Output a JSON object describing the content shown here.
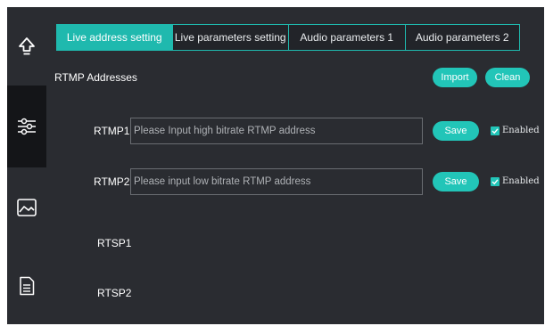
{
  "sidebar": {
    "items": [
      {
        "icon": "upload-icon",
        "name": "upload"
      },
      {
        "icon": "sliders-icon",
        "name": "settings"
      },
      {
        "icon": "image-icon",
        "name": "image"
      },
      {
        "icon": "document-icon",
        "name": "document"
      }
    ]
  },
  "tabs": [
    {
      "label": "Live address setting",
      "active": true
    },
    {
      "label": "Live parameters setting",
      "active": false
    },
    {
      "label": "Audio parameters 1",
      "active": false
    },
    {
      "label": "Audio parameters 2",
      "active": false
    }
  ],
  "section_title": "RTMP Addresses",
  "buttons": {
    "import": "Import",
    "clean": "Clean"
  },
  "rows": [
    {
      "label": "RTMP1",
      "placeholder": "Please Input high bitrate RTMP address",
      "value": "",
      "save": "Save",
      "enabled_label": "Enabled",
      "enabled": true
    },
    {
      "label": "RTMP2",
      "placeholder": "Please input low bitrate RTMP address",
      "value": "",
      "save": "Save",
      "enabled_label": "Enabled",
      "enabled": true
    },
    {
      "label": "RTSP1"
    },
    {
      "label": "RTSP2"
    }
  ],
  "colors": {
    "accent": "#1fb9ae",
    "background": "#2a2c31",
    "sidebar_dark": "#141518"
  }
}
